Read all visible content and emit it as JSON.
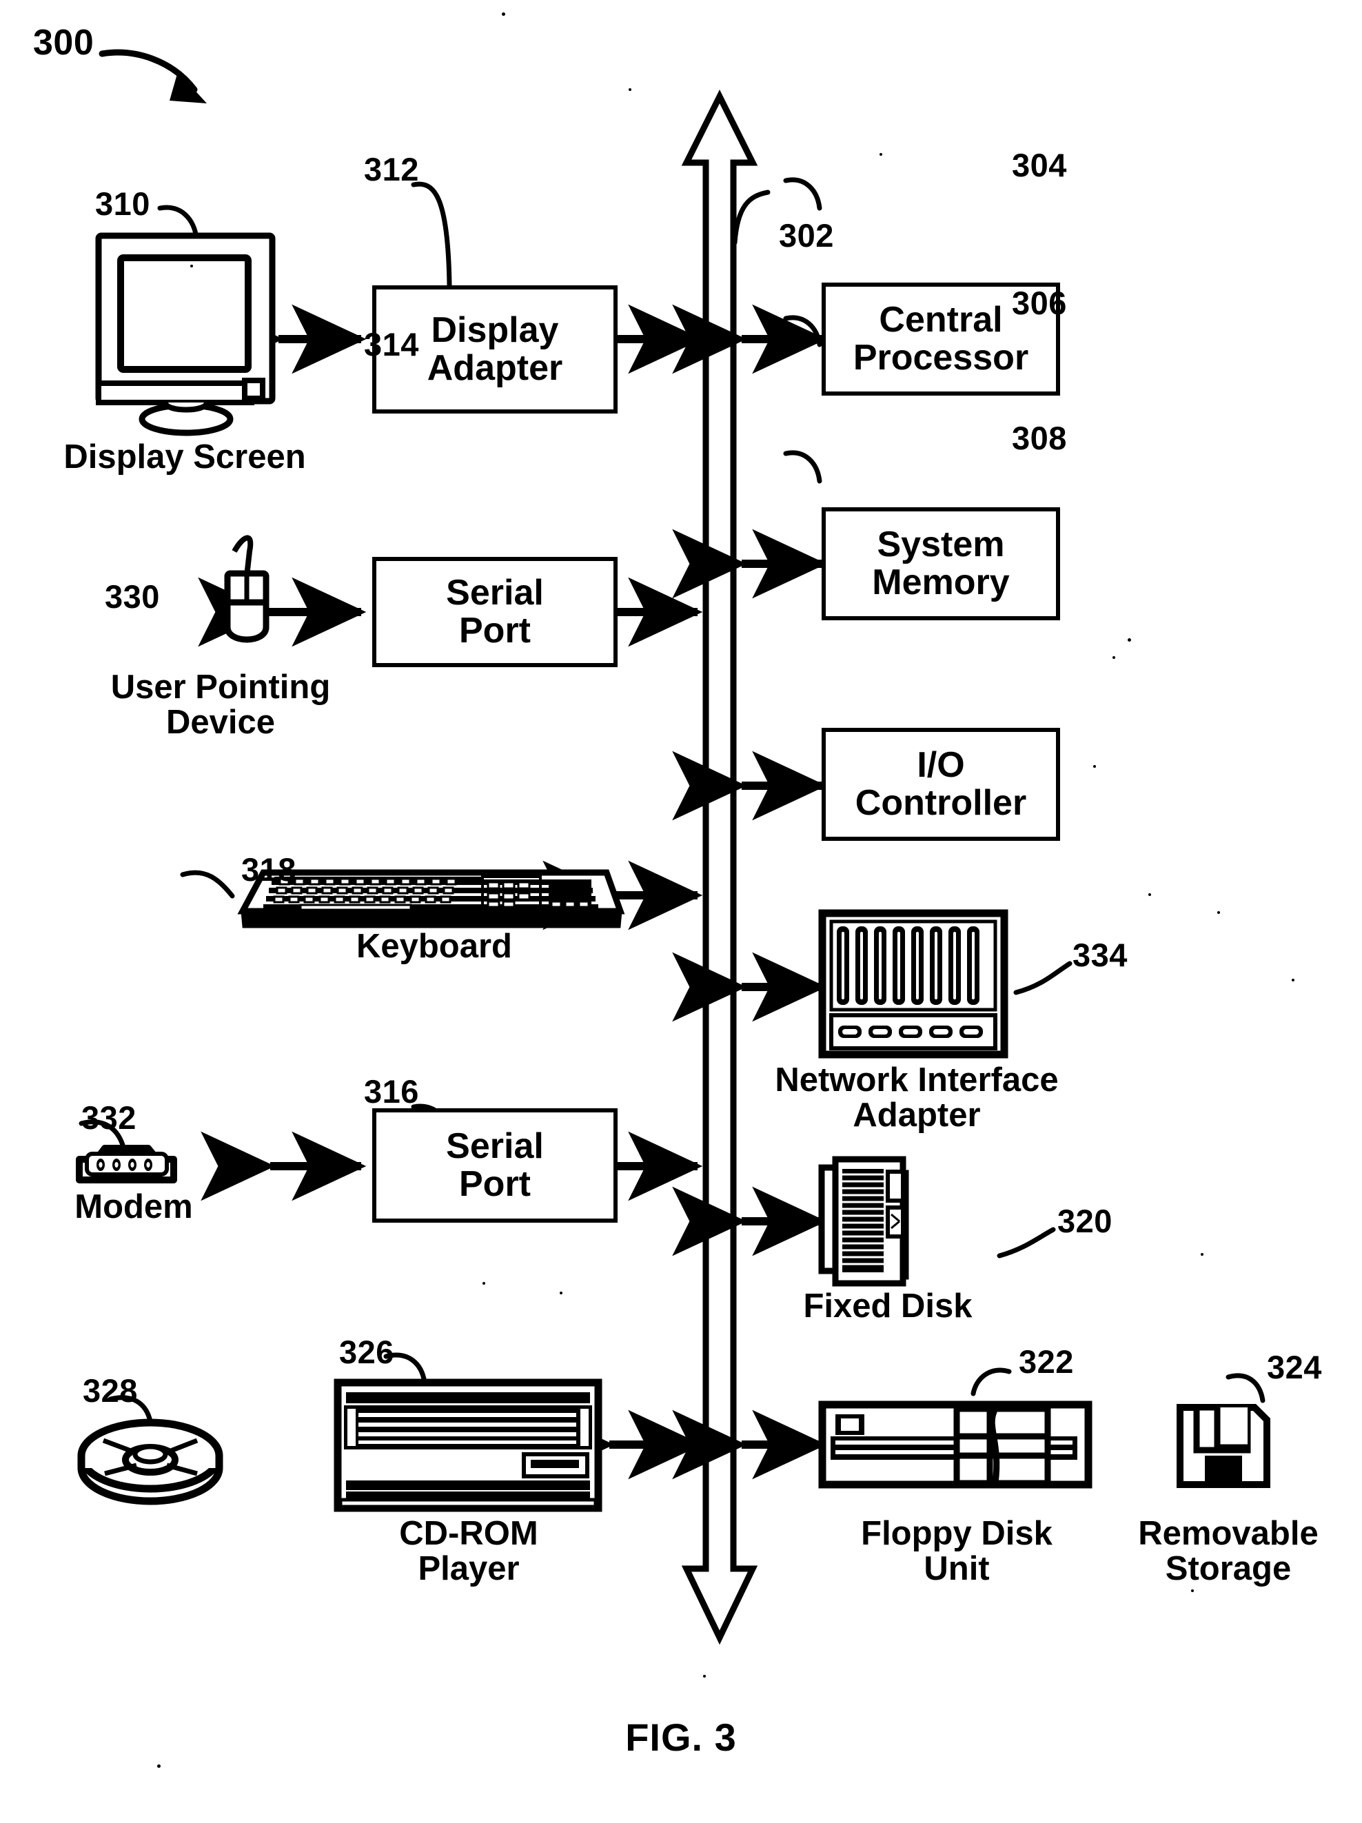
{
  "figure": {
    "title": "FIG. 3",
    "system_numeral": "300"
  },
  "bus": {
    "numeral": "302",
    "name": "system bus"
  },
  "boxes": [
    {
      "id": "display-adapter",
      "numeral": "312",
      "label": "Display\nAdapter"
    },
    {
      "id": "central-processor",
      "numeral": "304",
      "label": "Central\nProcessor"
    },
    {
      "id": "serial-port-1",
      "numeral": "314",
      "label": "Serial\nPort"
    },
    {
      "id": "system-memory",
      "numeral": "306",
      "label": "System\nMemory"
    },
    {
      "id": "io-controller",
      "numeral": "308",
      "label": "I/O\nController"
    },
    {
      "id": "serial-port-2",
      "numeral": "316",
      "label": "Serial\nPort"
    }
  ],
  "devices": [
    {
      "id": "display-screen",
      "numeral": "310",
      "caption": "Display Screen"
    },
    {
      "id": "user-pointing-device",
      "numeral": "330",
      "caption": "User Pointing\nDevice"
    },
    {
      "id": "keyboard",
      "numeral": "318",
      "caption": "Keyboard"
    },
    {
      "id": "network-interface-adapter",
      "numeral": "334",
      "caption": "Network Interface\nAdapter"
    },
    {
      "id": "modem",
      "numeral": "332",
      "caption": "Modem"
    },
    {
      "id": "fixed-disk",
      "numeral": "320",
      "caption": "Fixed Disk"
    },
    {
      "id": "cd-rom-player",
      "numeral": "326",
      "caption": "CD-ROM\nPlayer"
    },
    {
      "id": "compact-disc",
      "numeral": "328",
      "caption": ""
    },
    {
      "id": "floppy-disk-unit",
      "numeral": "322",
      "caption": "Floppy Disk\nUnit"
    },
    {
      "id": "removable-storage",
      "numeral": "324",
      "caption": "Removable\nStorage"
    }
  ],
  "colors": {
    "ink": "#000000",
    "paper": "#ffffff"
  }
}
